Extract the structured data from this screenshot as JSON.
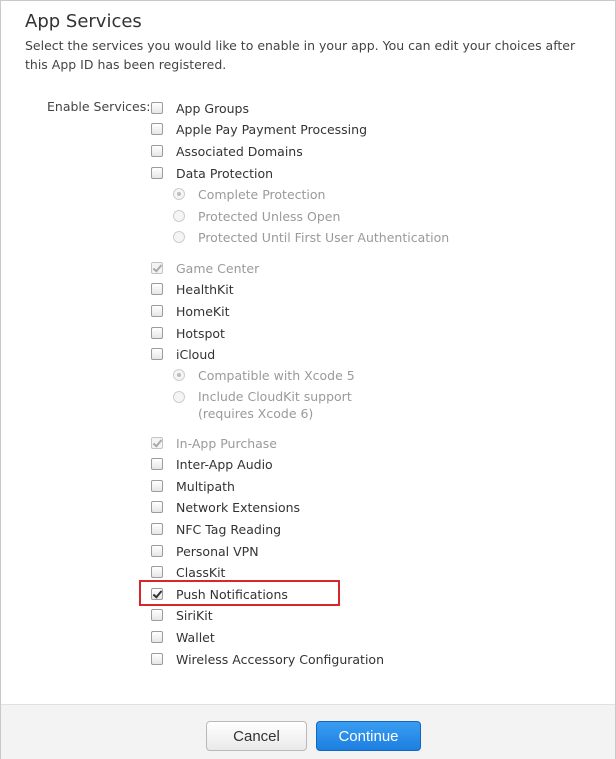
{
  "dialog": {
    "title": "App Services",
    "description": "Select the services you would like to enable in your app. You can edit your choices after this App ID has been registered.",
    "enable_label": "Enable Services:"
  },
  "services": {
    "app_groups": "App Groups",
    "apple_pay": "Apple Pay Payment Processing",
    "associated_domains": "Associated Domains",
    "data_protection": "Data Protection",
    "dp_complete": "Complete Protection",
    "dp_unless_open": "Protected Unless Open",
    "dp_until_auth": "Protected Until First User Authentication",
    "game_center": "Game Center",
    "healthkit": "HealthKit",
    "homekit": "HomeKit",
    "hotspot": "Hotspot",
    "icloud": "iCloud",
    "icloud_xcode5": "Compatible with Xcode 5",
    "icloud_cloudkit_line1": "Include CloudKit support",
    "icloud_cloudkit_line2": "(requires Xcode 6)",
    "in_app_purchase": "In-App Purchase",
    "inter_app_audio": "Inter-App Audio",
    "multipath": "Multipath",
    "network_extensions": "Network Extensions",
    "nfc": "NFC Tag Reading",
    "personal_vpn": "Personal VPN",
    "classkit": "ClassKit",
    "push_notifications": "Push Notifications",
    "sirikit": "SiriKit",
    "wallet": "Wallet",
    "wireless_accessory": "Wireless Accessory Configuration"
  },
  "footer": {
    "cancel_label": "Cancel",
    "continue_label": "Continue"
  },
  "colors": {
    "highlight": "#d6272d",
    "primary_button": "#1d7fe0"
  }
}
